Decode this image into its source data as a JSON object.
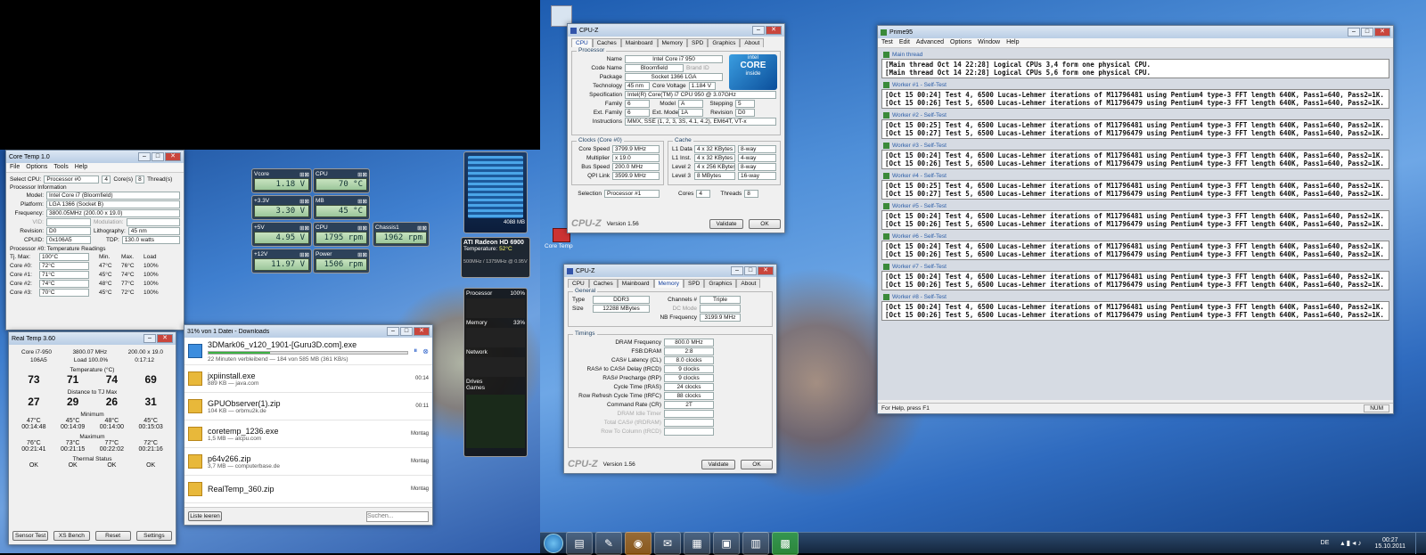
{
  "coretemp": {
    "title": "Core Temp 1.0",
    "menu": [
      "File",
      "Options",
      "Tools",
      "Help"
    ],
    "select_cpu_label": "Select CPU:",
    "select_cpu_value": "Processor #0",
    "cores_value": "4",
    "cores_label": "Core(s)",
    "threads_value": "8",
    "threads_label": "Thread(s)",
    "proc_info_label": "Processor Information",
    "model_label": "Model:",
    "model_value": "Intel Core i7 (Bloomfield)",
    "platform_label": "Platform:",
    "platform_value": "LGA 1366 (Socket B)",
    "frequency_label": "Frequency:",
    "frequency_value": "3800.05MHz (200.00 x 19.0)",
    "vid_label": "VID:",
    "modulation_label": "Modulation:",
    "revision_label": "Revision:",
    "revision_value": "D0",
    "lithography_label": "Lithography:",
    "lithography_value": "45 nm",
    "cpuid_label": "CPUID:",
    "cpuid_value": "0x106A5",
    "tdp_label": "TDP:",
    "tdp_value": "130.0 watts",
    "temp_readings_label": "Processor #0: Temperature Readings",
    "tjmax_label": "Tj. Max:",
    "tjmax_value": "100°C",
    "col_min": "Min.",
    "col_max": "Max.",
    "col_load": "Load",
    "cores": [
      {
        "name": "Core #0:",
        "temp": "72°C",
        "min": "47°C",
        "max": "76°C",
        "load": "100%"
      },
      {
        "name": "Core #1:",
        "temp": "71°C",
        "min": "45°C",
        "max": "74°C",
        "load": "100%"
      },
      {
        "name": "Core #2:",
        "temp": "74°C",
        "min": "48°C",
        "max": "77°C",
        "load": "100%"
      },
      {
        "name": "Core #3:",
        "temp": "70°C",
        "min": "45°C",
        "max": "72°C",
        "load": "100%"
      }
    ]
  },
  "realtemp": {
    "title": "Real Temp 3.60",
    "cpu": "Core i7-950",
    "freq": "3800.07 MHz",
    "mult": "200.00 x 19.0",
    "vid": "106A5",
    "load": "Load 100.0%",
    "time": "0:17:12",
    "temperature_label": "Temperature (°C)",
    "temps": [
      "73",
      "71",
      "74",
      "69"
    ],
    "distance_label": "Distance to TJ Max",
    "distances": [
      "27",
      "29",
      "26",
      "31"
    ],
    "minimum_label": "Minimum",
    "mins": [
      "47°C",
      "45°C",
      "48°C",
      "45°C"
    ],
    "min_times": [
      "00:14:48",
      "00:14:09",
      "00:14:00",
      "00:15:03"
    ],
    "maximum_label": "Maximum",
    "maxs": [
      "76°C",
      "73°C",
      "77°C",
      "72°C"
    ],
    "max_times": [
      "00:21:41",
      "00:21:15",
      "00:22:02",
      "00:21:16"
    ],
    "thermal_label": "Thermal Status",
    "thermal": [
      "OK",
      "OK",
      "OK",
      "OK"
    ],
    "buttons": [
      "Sensor Test",
      "XS Bench",
      "Reset",
      "Settings"
    ]
  },
  "gadgets": {
    "vcore_label": "Vcore",
    "vcore": "1.18 V",
    "v33_label": "+3.3V",
    "v33": "3.30 V",
    "v5_label": "+5V",
    "v5": "4.95 V",
    "v12_label": "+12V",
    "v12": "11.97 V",
    "cpu_label": "CPU",
    "cpu_temp": "70 °C",
    "mb_label": "MB",
    "mb_temp": "45 °C",
    "cpu2_label": "CPU",
    "cpu_fan": "1795 rpm",
    "chassis_label": "Chassis1",
    "chassis_fan": "1962 rpm",
    "power_label": "Power",
    "power": "1506 rpm",
    "ati_title": "ATI Radeon HD 6900",
    "ati_temp_label": "Temperature:",
    "ati_temp": "52°C",
    "ati_clock": "500MHz / 1375MHz @ 0.95V",
    "mem_label": "4088 MB"
  },
  "sysmon": {
    "processor_label": "Processor",
    "processor_pct": "100%",
    "memory_label": "Memory",
    "memory_pct": "33%",
    "network_label": "Network",
    "drives_label": "Drives",
    "games_label": "Games"
  },
  "download": {
    "title": "31% von 1 Datei - Downloads",
    "items": [
      {
        "name": "3DMark06_v120_1901-[Guru3D.com].exe",
        "sub": "22 Minuten verbleibend — 184 von 585 MB (361 KB/s)",
        "time": "",
        "progress": 0.31
      },
      {
        "name": "jxpiinstall.exe",
        "sub": "889 KB — java.com",
        "time": "00:14"
      },
      {
        "name": "GPUObserver(1).zip",
        "sub": "104 KB — orbmu2k.de",
        "time": "00:11"
      },
      {
        "name": "coretemp_1236.exe",
        "sub": "1,5 MB — alcpu.com",
        "time": "Montag"
      },
      {
        "name": "p64v266.zip",
        "sub": "3,7 MB — computerbase.de",
        "time": "Montag"
      },
      {
        "name": "RealTemp_360.zip",
        "sub": "",
        "time": "Montag"
      }
    ],
    "clear_button": "Liste leeren",
    "search_placeholder": "Suchen..."
  },
  "cpuz1": {
    "title": "CPU-Z",
    "tabs": [
      "CPU",
      "Caches",
      "Mainboard",
      "Memory",
      "SPD",
      "Graphics",
      "About"
    ],
    "processor_group": "Processor",
    "name_label": "Name",
    "name": "Intel Core i7 950",
    "codename_label": "Code Name",
    "codename": "Bloomfield",
    "brandid_label": "Brand ID",
    "package_label": "Package",
    "package": "Socket 1366 LGA",
    "technology_label": "Technology",
    "technology": "45 nm",
    "corevoltage_label": "Core Voltage",
    "corevoltage": "1.184 V",
    "spec_label": "Specification",
    "spec": "Intel(R) Core(TM) i7 CPU 950 @ 3.07GHz",
    "family_label": "Family",
    "family": "6",
    "model_label": "Model",
    "model": "A",
    "stepping_label": "Stepping",
    "stepping": "5",
    "extfamily_label": "Ext. Family",
    "extfamily": "6",
    "extmodel_label": "Ext. Model",
    "extmodel": "1A",
    "revision_label": "Revision",
    "revision": "D0",
    "instructions_label": "Instructions",
    "instructions": "MMX, SSE (1, 2, 3, 3S, 4.1, 4.2), EM64T, VT-x",
    "clocks_group": "Clocks (Core #0)",
    "corespeed_label": "Core Speed",
    "corespeed": "3799.9 MHz",
    "multiplier_label": "Multiplier",
    "multiplier": "x 19.0",
    "busspeed_label": "Bus Speed",
    "busspeed": "200.0 MHz",
    "qpi_label": "QPI Link",
    "qpi": "3599.9 MHz",
    "cache_group": "Cache",
    "l1d_label": "L1 Data",
    "l1d": "4 x 32 KBytes",
    "l1d_way": "8-way",
    "l1i_label": "L1 Inst.",
    "l1i": "4 x 32 KBytes",
    "l1i_way": "4-way",
    "l2_label": "Level 2",
    "l2": "4 x 256 KBytes",
    "l2_way": "8-way",
    "l3_label": "Level 3",
    "l3": "8 MBytes",
    "l3_way": "16-way",
    "selection_label": "Selection",
    "selection": "Processor #1",
    "cores_label": "Cores",
    "cores": "4",
    "threads_label": "Threads",
    "threads": "8",
    "version": "Version 1.56",
    "validate": "Validate",
    "ok": "OK",
    "intel_logo": "intel",
    "intel_core": "CORE",
    "intel_inside": "inside"
  },
  "cpuz2": {
    "title": "CPU-Z",
    "tabs": [
      "CPU",
      "Caches",
      "Mainboard",
      "Memory",
      "SPD",
      "Graphics",
      "About"
    ],
    "general_group": "General",
    "type_label": "Type",
    "type": "DDR3",
    "channels_label": "Channels #",
    "channels": "Triple",
    "size_label": "Size",
    "size": "12288 MBytes",
    "dcmode_label": "DC Mode",
    "nbfreq_label": "NB Frequency",
    "nbfreq": "3199.9 MHz",
    "timings_group": "Timings",
    "timings": [
      {
        "label": "DRAM Frequency",
        "value": "800.0 MHz"
      },
      {
        "label": "FSB:DRAM",
        "value": "2:8"
      },
      {
        "label": "CAS# Latency (CL)",
        "value": "8.0 clocks"
      },
      {
        "label": "RAS# to CAS# Delay (tRCD)",
        "value": "9 clocks"
      },
      {
        "label": "RAS# Precharge (tRP)",
        "value": "9 clocks"
      },
      {
        "label": "Cycle Time (tRAS)",
        "value": "24 clocks"
      },
      {
        "label": "Row Refresh Cycle Time (tRFC)",
        "value": "88 clocks"
      },
      {
        "label": "Command Rate (CR)",
        "value": "2T"
      },
      {
        "label": "DRAM Idle Timer",
        "value": ""
      },
      {
        "label": "Total CAS# (tRDRAM)",
        "value": ""
      },
      {
        "label": "Row To Column (tRCD)",
        "value": ""
      }
    ],
    "version": "Version 1.56",
    "validate": "Validate",
    "ok": "OK"
  },
  "prime95": {
    "title": "Prime95",
    "menu": [
      "Test",
      "Edit",
      "Advanced",
      "Options",
      "Window",
      "Help"
    ],
    "main_label": "Main thread",
    "main_lines": [
      "[Main thread Oct 14 22:28] Logical CPUs 3,4 form one physical CPU.",
      "[Main thread Oct 14 22:28] Logical CPUs 5,6 form one physical CPU."
    ],
    "workers": [
      {
        "label": "Worker #1 - Self-Test",
        "lines": [
          "[Oct 15 00:24] Test 4, 6500 Lucas-Lehmer iterations of M11796481 using Pentium4 type-3 FFT length 640K, Pass1=640, Pass2=1K.",
          "[Oct 15 00:26] Test 5, 6500 Lucas-Lehmer iterations of M11796479 using Pentium4 type-3 FFT length 640K, Pass1=640, Pass2=1K."
        ]
      },
      {
        "label": "Worker #2 - Self-Test",
        "lines": [
          "[Oct 15 00:25] Test 4, 6500 Lucas-Lehmer iterations of M11796481 using Pentium4 type-3 FFT length 640K, Pass1=640, Pass2=1K.",
          "[Oct 15 00:27] Test 5, 6500 Lucas-Lehmer iterations of M11796479 using Pentium4 type-3 FFT length 640K, Pass1=640, Pass2=1K."
        ]
      },
      {
        "label": "Worker #3 - Self-Test",
        "lines": [
          "[Oct 15 00:24] Test 4, 6500 Lucas-Lehmer iterations of M11796481 using Pentium4 type-3 FFT length 640K, Pass1=640, Pass2=1K.",
          "[Oct 15 00:26] Test 5, 6500 Lucas-Lehmer iterations of M11796479 using Pentium4 type-3 FFT length 640K, Pass1=640, Pass2=1K."
        ]
      },
      {
        "label": "Worker #4 - Self-Test",
        "lines": [
          "[Oct 15 00:25] Test 4, 6500 Lucas-Lehmer iterations of M11796481 using Pentium4 type-3 FFT length 640K, Pass1=640, Pass2=1K.",
          "[Oct 15 00:27] Test 5, 6500 Lucas-Lehmer iterations of M11796479 using Pentium4 type-3 FFT length 640K, Pass1=640, Pass2=1K."
        ]
      },
      {
        "label": "Worker #5 - Self-Test",
        "lines": [
          "[Oct 15 00:24] Test 4, 6500 Lucas-Lehmer iterations of M11796481 using Pentium4 type-3 FFT length 640K, Pass1=640, Pass2=1K.",
          "[Oct 15 00:26] Test 5, 6500 Lucas-Lehmer iterations of M11796479 using Pentium4 type-3 FFT length 640K, Pass1=640, Pass2=1K."
        ]
      },
      {
        "label": "Worker #6 - Self-Test",
        "lines": [
          "[Oct 15 00:24] Test 4, 6500 Lucas-Lehmer iterations of M11796481 using Pentium4 type-3 FFT length 640K, Pass1=640, Pass2=1K.",
          "[Oct 15 00:26] Test 5, 6500 Lucas-Lehmer iterations of M11796479 using Pentium4 type-3 FFT length 640K, Pass1=640, Pass2=1K."
        ]
      },
      {
        "label": "Worker #7 - Self-Test",
        "lines": [
          "[Oct 15 00:24] Test 4, 6500 Lucas-Lehmer iterations of M11796481 using Pentium4 type-3 FFT length 640K, Pass1=640, Pass2=1K.",
          "[Oct 15 00:26] Test 5, 6500 Lucas-Lehmer iterations of M11796479 using Pentium4 type-3 FFT length 640K, Pass1=640, Pass2=1K."
        ]
      },
      {
        "label": "Worker #8 - Self-Test",
        "lines": [
          "[Oct 15 00:24] Test 4, 6500 Lucas-Lehmer iterations of M11796481 using Pentium4 type-3 FFT length 640K, Pass1=640, Pass2=1K.",
          "[Oct 15 00:26] Test 5, 6500 Lucas-Lehmer iterations of M11796479 using Pentium4 type-3 FFT length 640K, Pass1=640, Pass2=1K."
        ]
      }
    ],
    "status": "For Help, press F1",
    "num": "NUM"
  },
  "desktop": {
    "coretemp_icon": "Core Temp"
  },
  "taskbar": {
    "lang": "DE",
    "time": "00:27",
    "date": "15.10.2011"
  }
}
